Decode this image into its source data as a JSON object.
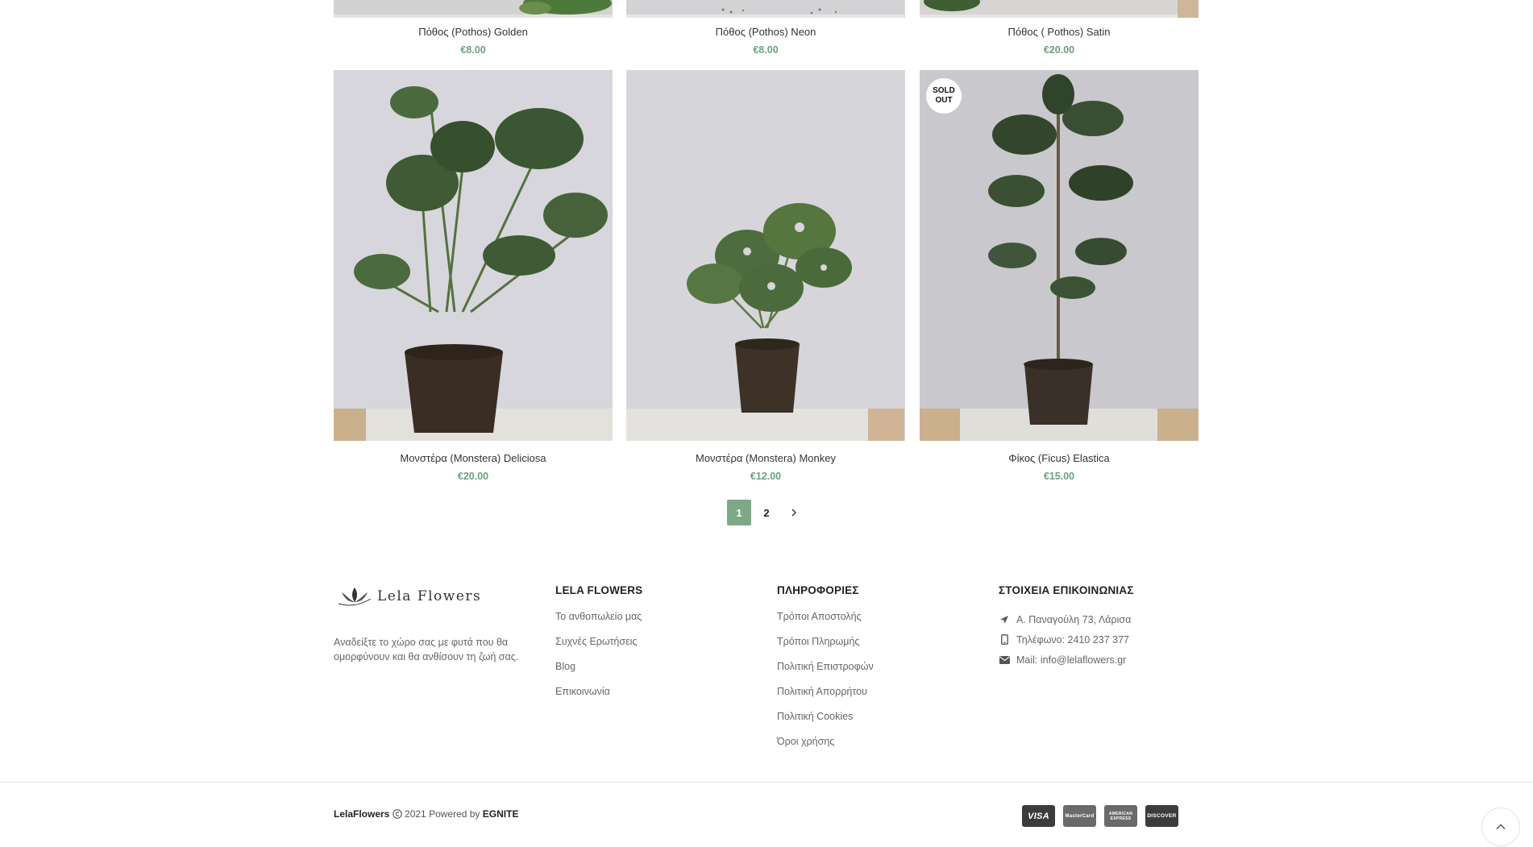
{
  "products_top": [
    {
      "name": "Πόθος (Pothos) Golden",
      "price": "€8.00"
    },
    {
      "name": "Πόθος (Pothos) Neon",
      "price": "€8.00"
    },
    {
      "name": "Πόθος ( Pothos) Satin",
      "price": "€20.00"
    }
  ],
  "products": [
    {
      "name": "Μονστέρα (Monstera) Deliciosa",
      "price": "€20.00"
    },
    {
      "name": "Μονστέρα (Monstera) Monkey",
      "price": "€12.00"
    },
    {
      "name": "Φίκος (Ficus) Elastica",
      "price": "€15.00",
      "badge_line1": "SOLD",
      "badge_line2": "OUT"
    }
  ],
  "pagination": {
    "page1": "1",
    "page2": "2",
    "next_icon": "chevron-right-icon"
  },
  "footer": {
    "logo_text": "Lela Flowers",
    "description": "Αναδείξτε το χώρο σας με φυτά που θα ομορφύνουν και θα ανθίσουν τη ζωή σας.",
    "col1": {
      "title": "LELA FLOWERS",
      "links": [
        "Το ανθοπωλείο μας",
        "Συχνές Ερωτήσεις",
        "Blog",
        "Επικοινωνία"
      ]
    },
    "col2": {
      "title": "ΠΛΗΡΟΦΟΡΙΕΣ",
      "links": [
        "Τρόποι Αποστολής",
        "Τρόποι Πληρωμής",
        "Πολιτική Επιστροφών",
        "Πολιτική Απορρήτου",
        "Πολιτική Cookies",
        "Όροι χρήσης"
      ]
    },
    "col3": {
      "title": "ΣΤΟΙΧΕΙΑ ΕΠΙΚΟΙΝΩΝΙΑΣ",
      "address": "Α. Παναγούλη 73, Λάρισα",
      "phone": "Τηλέφωνο: 2410 237 377",
      "mail": "Mail: info@lelaflowers.gr"
    }
  },
  "copyright": {
    "brand": "LelaFlowers",
    "text": " 2021 Powered by ",
    "powered": "EGNITE"
  },
  "payment_cards": [
    "VISA",
    "MasterCard",
    "AMERICAN EXPRESS",
    "DISCOVER"
  ],
  "colors": {
    "accent": "#7fa886",
    "price": "#6aa37b"
  }
}
